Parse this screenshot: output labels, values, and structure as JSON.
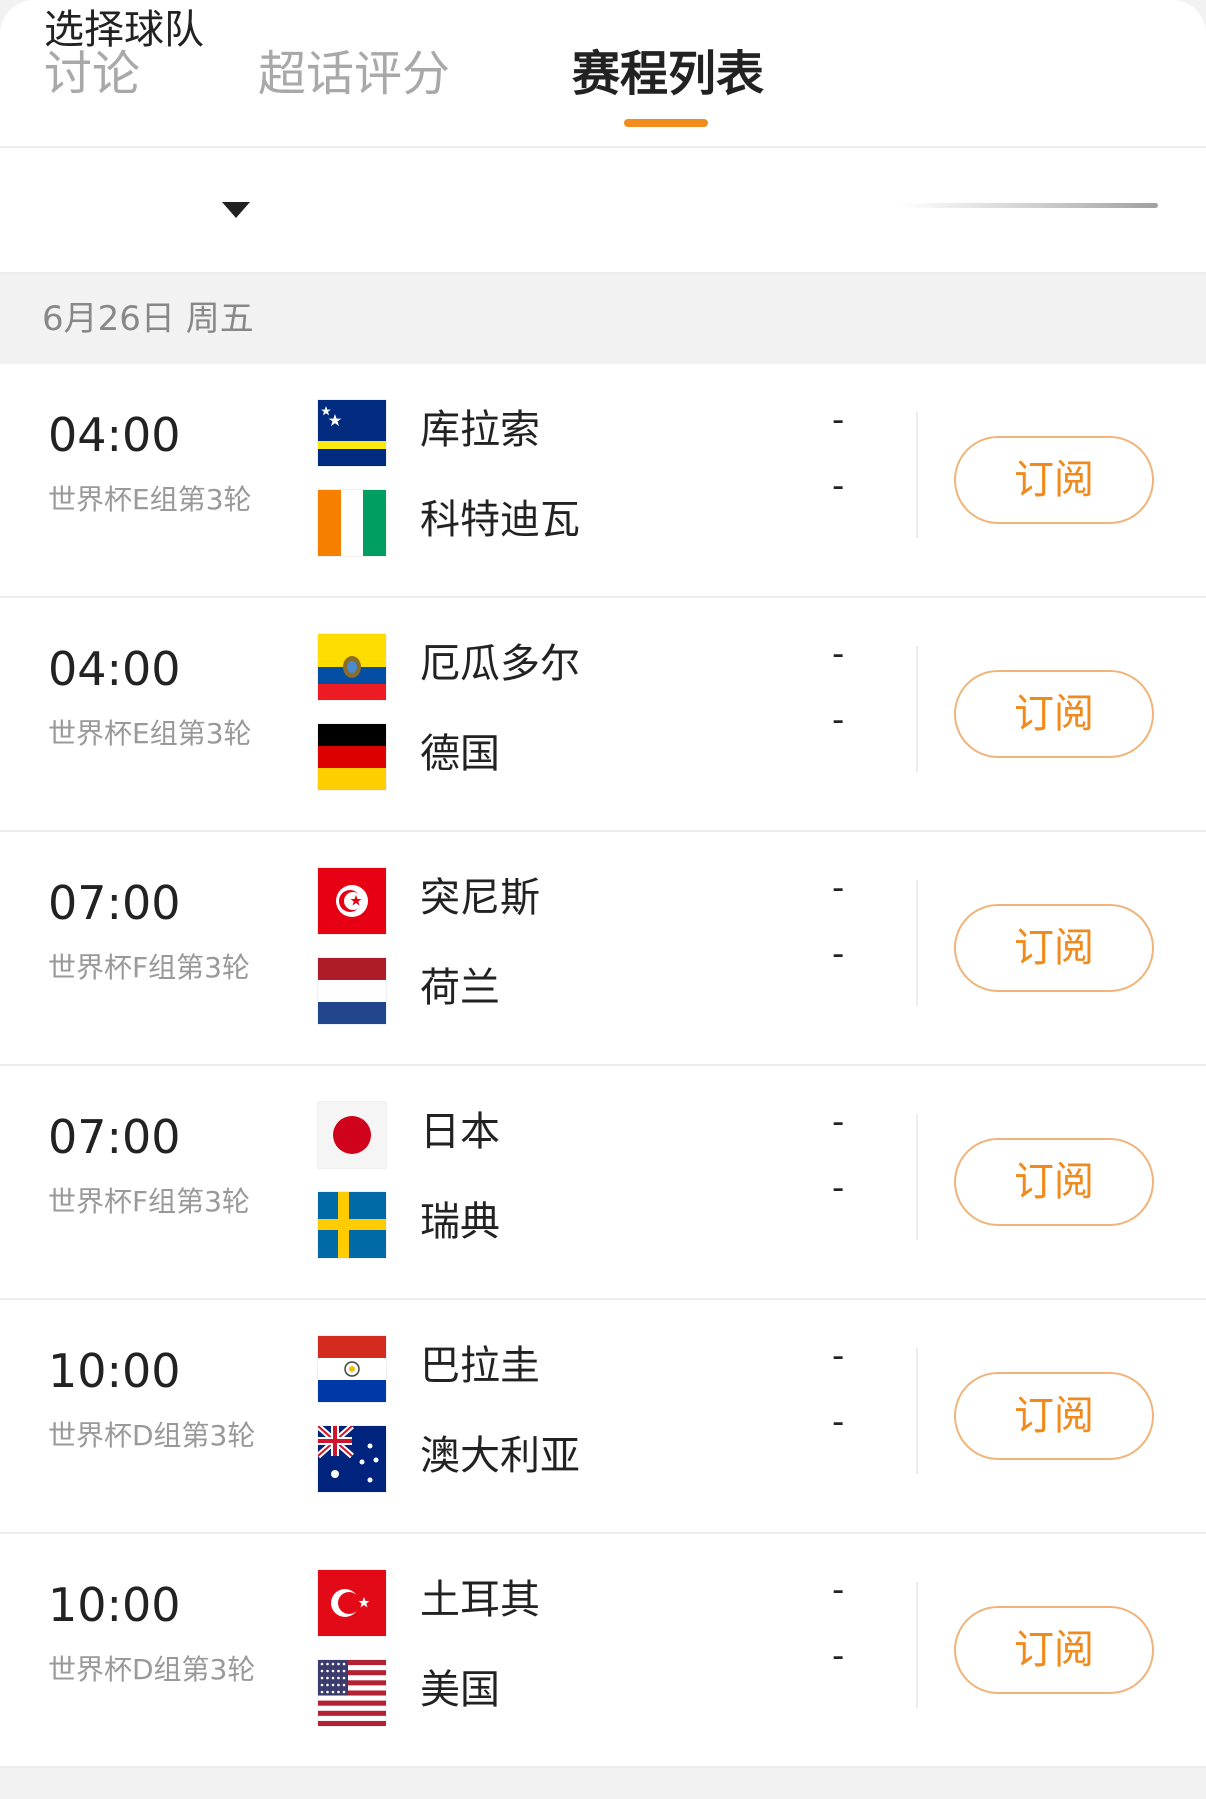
{
  "tabs": [
    {
      "label": "讨论"
    },
    {
      "label": "超话评分"
    },
    {
      "label": "赛程列表"
    }
  ],
  "filter": {
    "label": "选择球队"
  },
  "date_header": "6月26日 周五",
  "accent_color": "#f28c1e",
  "subscribe_label": "订阅",
  "matches": [
    {
      "time": "04:00",
      "group": "世界杯E组第3轮",
      "home": {
        "name": "库拉索",
        "flag": "curacao",
        "score": "-"
      },
      "away": {
        "name": "科特迪瓦",
        "flag": "ivory-coast",
        "score": "-"
      }
    },
    {
      "time": "04:00",
      "group": "世界杯E组第3轮",
      "home": {
        "name": "厄瓜多尔",
        "flag": "ecuador",
        "score": "-"
      },
      "away": {
        "name": "德国",
        "flag": "germany",
        "score": "-"
      }
    },
    {
      "time": "07:00",
      "group": "世界杯F组第3轮",
      "home": {
        "name": "突尼斯",
        "flag": "tunisia",
        "score": "-"
      },
      "away": {
        "name": "荷兰",
        "flag": "netherlands",
        "score": "-"
      }
    },
    {
      "time": "07:00",
      "group": "世界杯F组第3轮",
      "home": {
        "name": "日本",
        "flag": "japan",
        "score": "-"
      },
      "away": {
        "name": "瑞典",
        "flag": "sweden",
        "score": "-"
      }
    },
    {
      "time": "10:00",
      "group": "世界杯D组第3轮",
      "home": {
        "name": "巴拉圭",
        "flag": "paraguay",
        "score": "-"
      },
      "away": {
        "name": "澳大利亚",
        "flag": "australia",
        "score": "-"
      }
    },
    {
      "time": "10:00",
      "group": "世界杯D组第3轮",
      "home": {
        "name": "土耳其",
        "flag": "turkey",
        "score": "-"
      },
      "away": {
        "name": "美国",
        "flag": "usa",
        "score": "-"
      }
    }
  ]
}
